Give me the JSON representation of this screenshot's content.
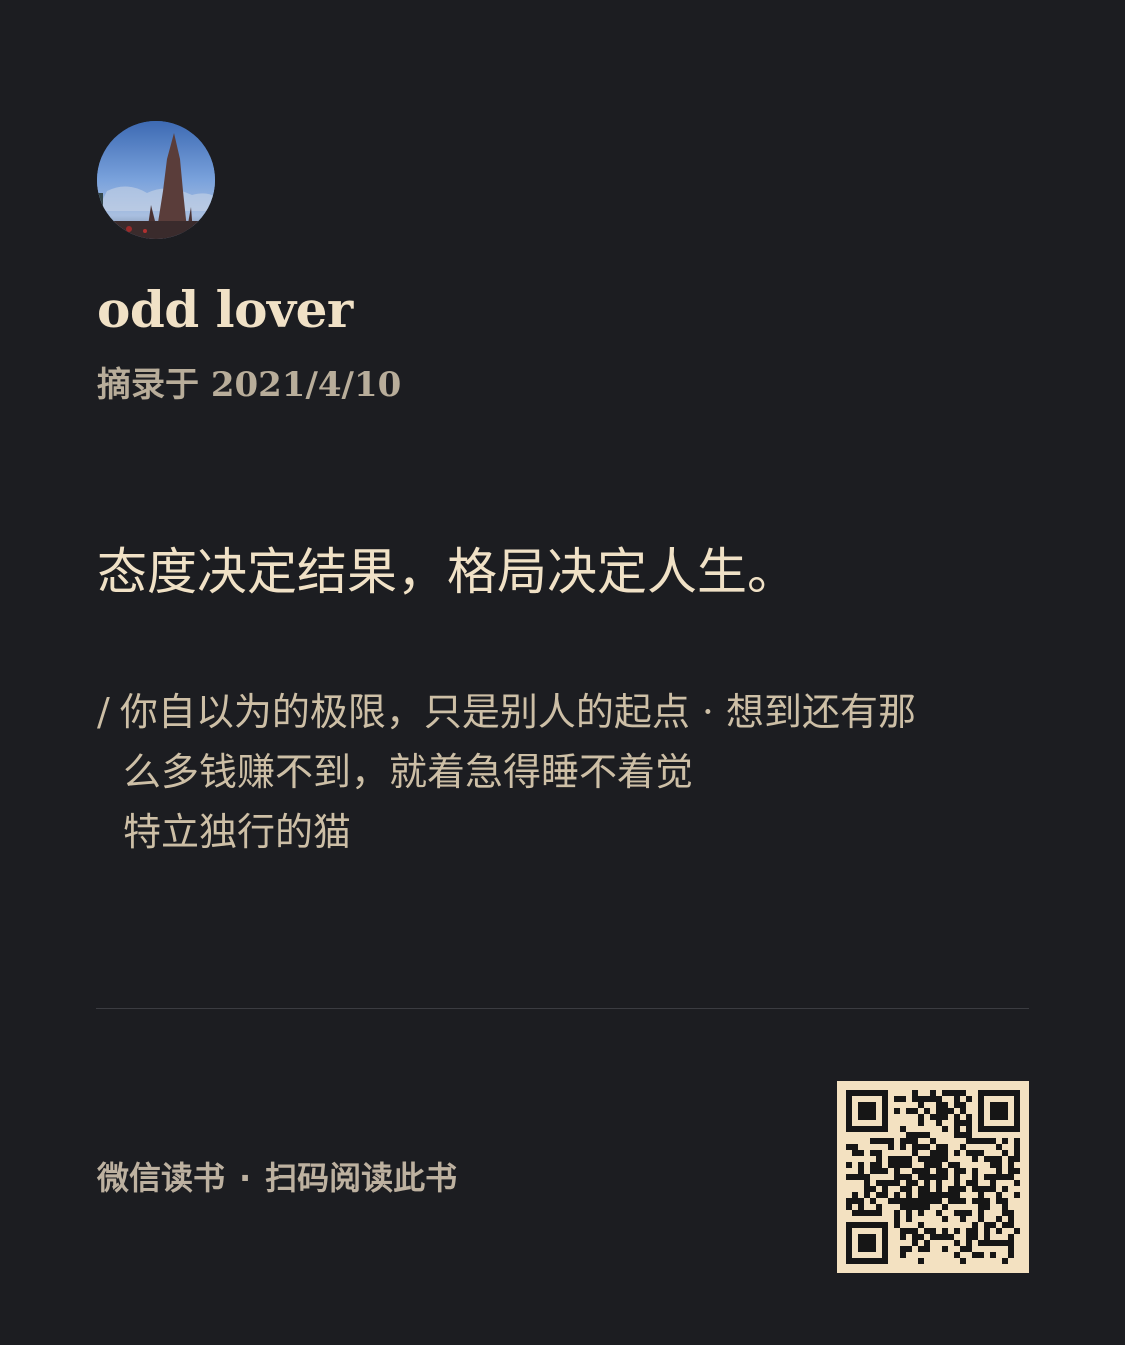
{
  "card": {
    "user": {
      "name": "odd lover",
      "avatar_icon": "cathedral-photo-avatar"
    },
    "excerpt_label": "摘录于 2021/4/10",
    "quote": "态度决定结果，格局决定人生。",
    "source": {
      "prefix": "/",
      "line1": "你自以为的极限，只是别人的起点 · 想到还有那",
      "line2": "么多钱赚不到，就着急得睡不着觉",
      "line3": "特立独行的猫"
    },
    "footer": {
      "app": "微信读书",
      "separator": "·",
      "action": "扫码阅读此书"
    },
    "qr_icon": "qr-code-icon"
  },
  "colors": {
    "background": "#1c1d21",
    "text_primary": "#f0e1c6",
    "text_secondary": "#b8ad9a",
    "qr_background": "#f3e1c1"
  }
}
